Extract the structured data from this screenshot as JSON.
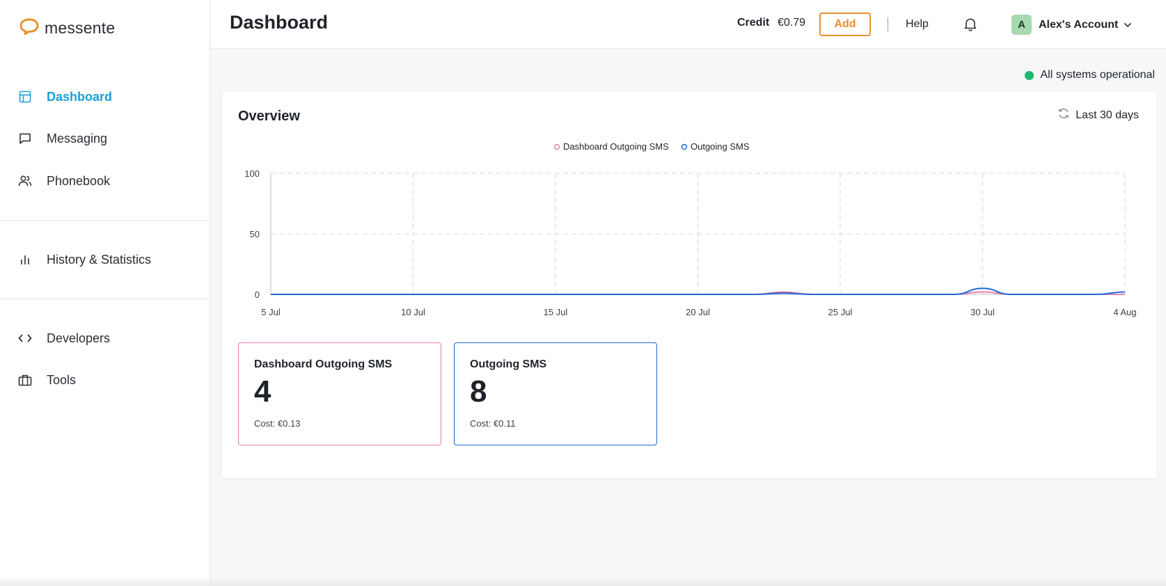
{
  "app": {
    "logo_text": "messente"
  },
  "sidebar": {
    "items": [
      {
        "label": "Dashboard",
        "icon": "layout-icon",
        "active": true
      },
      {
        "label": "Messaging",
        "icon": "chat-icon"
      },
      {
        "label": "Phonebook",
        "icon": "users-icon"
      },
      {
        "label": "History & Statistics",
        "icon": "bar-chart-icon"
      },
      {
        "label": "Developers",
        "icon": "code-icon"
      },
      {
        "label": "Tools",
        "icon": "briefcase-icon"
      }
    ]
  },
  "header": {
    "title": "Dashboard",
    "credit_label": "Credit",
    "credit_value": "€0.79",
    "add_label": "Add",
    "help_label": "Help",
    "account_initial": "A",
    "account_name": "Alex's Account"
  },
  "status": {
    "text": "All systems operational",
    "color": "#1cb66f"
  },
  "overview": {
    "title": "Overview",
    "range_label": "Last 30 days"
  },
  "stats": [
    {
      "title": "Dashboard Outgoing SMS",
      "value": "4",
      "cost": "Cost: €0.13",
      "color": "#e97fb0"
    },
    {
      "title": "Outgoing SMS",
      "value": "8",
      "cost": "Cost: €0.11",
      "color": "#1e68d6"
    }
  ],
  "chart_data": {
    "type": "line",
    "categories": [
      "5 Jul",
      "6 Jul",
      "7 Jul",
      "8 Jul",
      "9 Jul",
      "10 Jul",
      "11 Jul",
      "12 Jul",
      "13 Jul",
      "14 Jul",
      "15 Jul",
      "16 Jul",
      "17 Jul",
      "18 Jul",
      "19 Jul",
      "20 Jul",
      "21 Jul",
      "22 Jul",
      "23 Jul",
      "24 Jul",
      "25 Jul",
      "26 Jul",
      "27 Jul",
      "28 Jul",
      "29 Jul",
      "30 Jul",
      "31 Jul",
      "1 Aug",
      "2 Aug",
      "3 Aug",
      "4 Aug"
    ],
    "x_tick_labels": [
      "5 Jul",
      "10 Jul",
      "15 Jul",
      "20 Jul",
      "25 Jul",
      "30 Jul",
      "4 Aug"
    ],
    "y_ticks": [
      0,
      50,
      100
    ],
    "ylim": [
      0,
      100
    ],
    "grid": true,
    "legend_position": "top-center",
    "series": [
      {
        "name": "Dashboard Outgoing SMS",
        "color": "#e97fb0",
        "values": [
          0,
          0,
          0,
          0,
          0,
          0,
          0,
          0,
          0,
          0,
          0,
          0,
          0,
          0,
          0,
          0,
          0,
          0,
          2,
          0,
          0,
          0,
          0,
          0,
          0,
          2,
          0,
          0,
          0,
          0,
          0
        ]
      },
      {
        "name": "Outgoing SMS",
        "color": "#1e68d6",
        "values": [
          0,
          0,
          0,
          0,
          0,
          0,
          0,
          0,
          0,
          0,
          0,
          0,
          0,
          0,
          0,
          0,
          0,
          0,
          1,
          0,
          0,
          0,
          0,
          0,
          0,
          5,
          0,
          0,
          0,
          0,
          2
        ]
      }
    ]
  }
}
